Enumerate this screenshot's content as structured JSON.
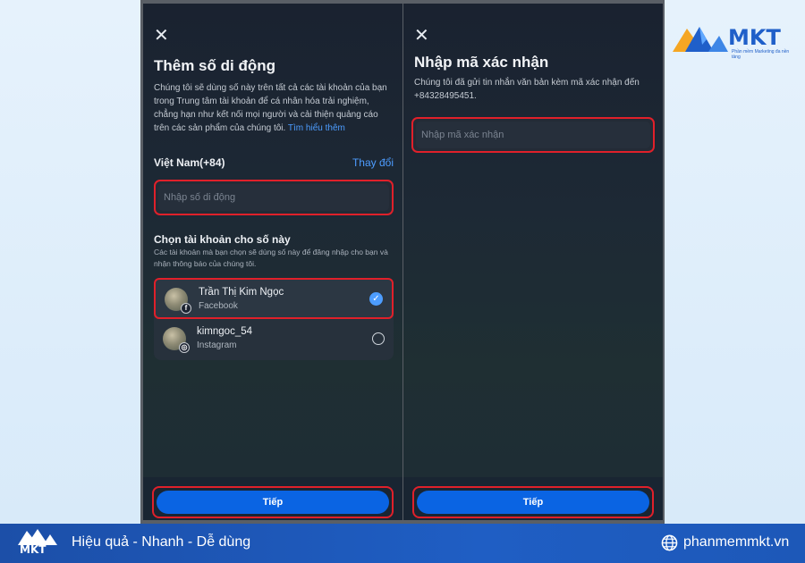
{
  "left_screen": {
    "title": "Thêm số di động",
    "description": "Chúng tôi sẽ dùng số này trên tất cả các tài khoản của bạn trong Trung tâm tài khoản để cá nhân hóa trải nghiệm, chẳng hạn như kết nối mọi người và cải thiện quảng cáo trên các sản phẩm của chúng tôi.",
    "learn_more": "Tìm hiểu thêm",
    "country": "Việt Nam(+84)",
    "change": "Thay đổi",
    "phone_placeholder": "Nhập số di động",
    "section_title": "Chọn tài khoản cho số này",
    "section_desc": "Các tài khoản mà bạn chọn sẽ dùng số này để đăng nhập cho bạn và nhận thông báo của chúng tôi.",
    "accounts": [
      {
        "name": "Trần Thị Kim Ngọc",
        "platform": "Facebook",
        "selected": true
      },
      {
        "name": "kimngoc_54",
        "platform": "Instagram",
        "selected": false
      }
    ],
    "next_button": "Tiếp"
  },
  "right_screen": {
    "title": "Nhập mã xác nhận",
    "description": "Chúng tôi đã gửi tin nhắn văn bản kèm mã xác nhận đến +84328495451.",
    "code_placeholder": "Nhập mã xác nhận",
    "next_button": "Tiếp"
  },
  "brand": {
    "logo_text": "MKT",
    "logo_tagline": "Phần mềm Marketing đa nền tảng",
    "slogan": "Hiệu quả - Nhanh - Dễ dùng",
    "website": "phanmemmkt.vn"
  },
  "colors": {
    "accent": "#4d9dff",
    "primary_button": "#0a64e3",
    "highlight_border": "#e0202a",
    "footer": "#1f5ec4"
  }
}
